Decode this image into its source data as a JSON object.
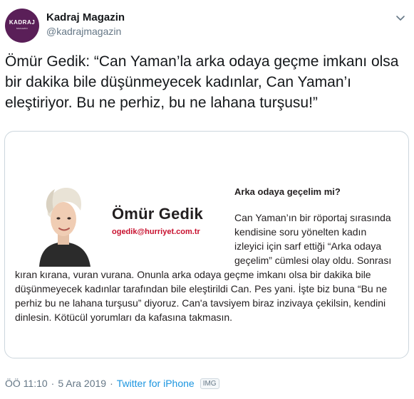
{
  "account": {
    "display_name": "Kadraj Magazin",
    "handle": "@kadrajmagazin",
    "avatar_text": "KADRAJ",
    "avatar_subtext": "MAGAZIN",
    "avatar_color": "#5a1f58"
  },
  "tweet": {
    "text": "Ömür Gedik: “Can Yaman’la arka odaya geçme imkanı olsa bir dakika bile düşünmeyecek kadınlar, Can Yaman’ı eleştiriyor. Bu ne perhiz, bu ne lahana turşusu!”"
  },
  "clipping": {
    "author_name": "Ömür Gedik",
    "author_email": "ogedik@hurriyet.com.tr",
    "column_title": "Arka odaya geçelim mi?",
    "paragraph_1": "Can Yaman’ın bir röportaj sırasında kendisine soru yönelten kadın izleyici için sarf ettiği “Arka odaya geçelim” cümlesi olay oldu. Sonrası",
    "paragraph_2": "kıran kırana, vuran vurana. Onunla arka odaya geçme imkanı olsa bir dakika bile düşünmeyecek kadınlar tarafından bile eleştirildi Can. Pes yani. İşte biz buna “Bu ne perhiz bu ne lahana turşusu” diyoruz. Can'a tavsiyem biraz inzivaya çekilsin, kendini dinlesin. Kötücül yorumları da kafasına takmasın.",
    "email_color": "#c8102e"
  },
  "footer": {
    "time": "ÖÖ 11:10",
    "separator": "·",
    "date": "5 Ara 2019",
    "source": "Twitter for iPhone",
    "badge": "IMG"
  },
  "icons": {
    "menu": "chevron-down-icon",
    "badge": "img-badge-icon"
  }
}
